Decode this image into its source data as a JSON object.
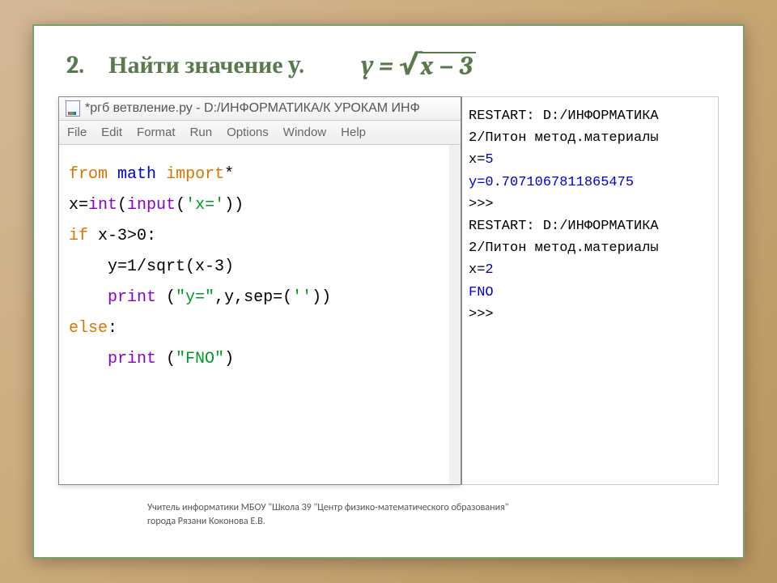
{
  "heading": {
    "number": "2.",
    "title": "Найти значение y.",
    "formula_lhs": "y",
    "formula_eq": "=",
    "formula_radicand": "x − 3"
  },
  "window": {
    "title": "*ргб ветвление.ру - D:/ИНФОРМАТИКА/К УРОКАМ ИНФ",
    "menu": [
      "File",
      "Edit",
      "Format",
      "Run",
      "Options",
      "Window",
      "Help"
    ]
  },
  "code": {
    "l1_from": "from",
    "l1_math": "math",
    "l1_import": "import",
    "l1_star": "*",
    "l2a": "x=",
    "l2b": "int",
    "l2c": "(",
    "l2d": "input",
    "l2e": "(",
    "l2f": "'x='",
    "l2g": "))",
    "l3a": "if",
    "l3b": " x-3>0:",
    "l4": "    y=1/sqrt(x-3)",
    "l5a": "    ",
    "l5b": "print",
    "l5c": " (",
    "l5d": "\"y=\"",
    "l5e": ",y,sep=(",
    "l5f": "''",
    "l5g": "))",
    "l6a": "else",
    "l6b": ":",
    "l7a": "    ",
    "l7b": "print",
    "l7c": " (",
    "l7d": "\"FNO\"",
    "l7e": ")"
  },
  "shell": {
    "r1": " RESTART: D:/ИНФОРМАТИКА",
    "r2": "2/Питон метод.материалы",
    "r3a": "x=",
    "r3b": "5",
    "r4": "y=0.7071067811865475",
    "r5": ">>> ",
    "r6": " RESTART: D:/ИНФОРМАТИКА",
    "r7": "2/Питон метод.материалы",
    "r8a": "x=",
    "r8b": "2",
    "r9": "FNO",
    "r10": ">>> "
  },
  "footer": {
    "line1": "Учитель информатики МБОУ \"Школа 39 \"Центр физико-математического образования\"",
    "line2": "города Рязани Коконова Е.В."
  }
}
